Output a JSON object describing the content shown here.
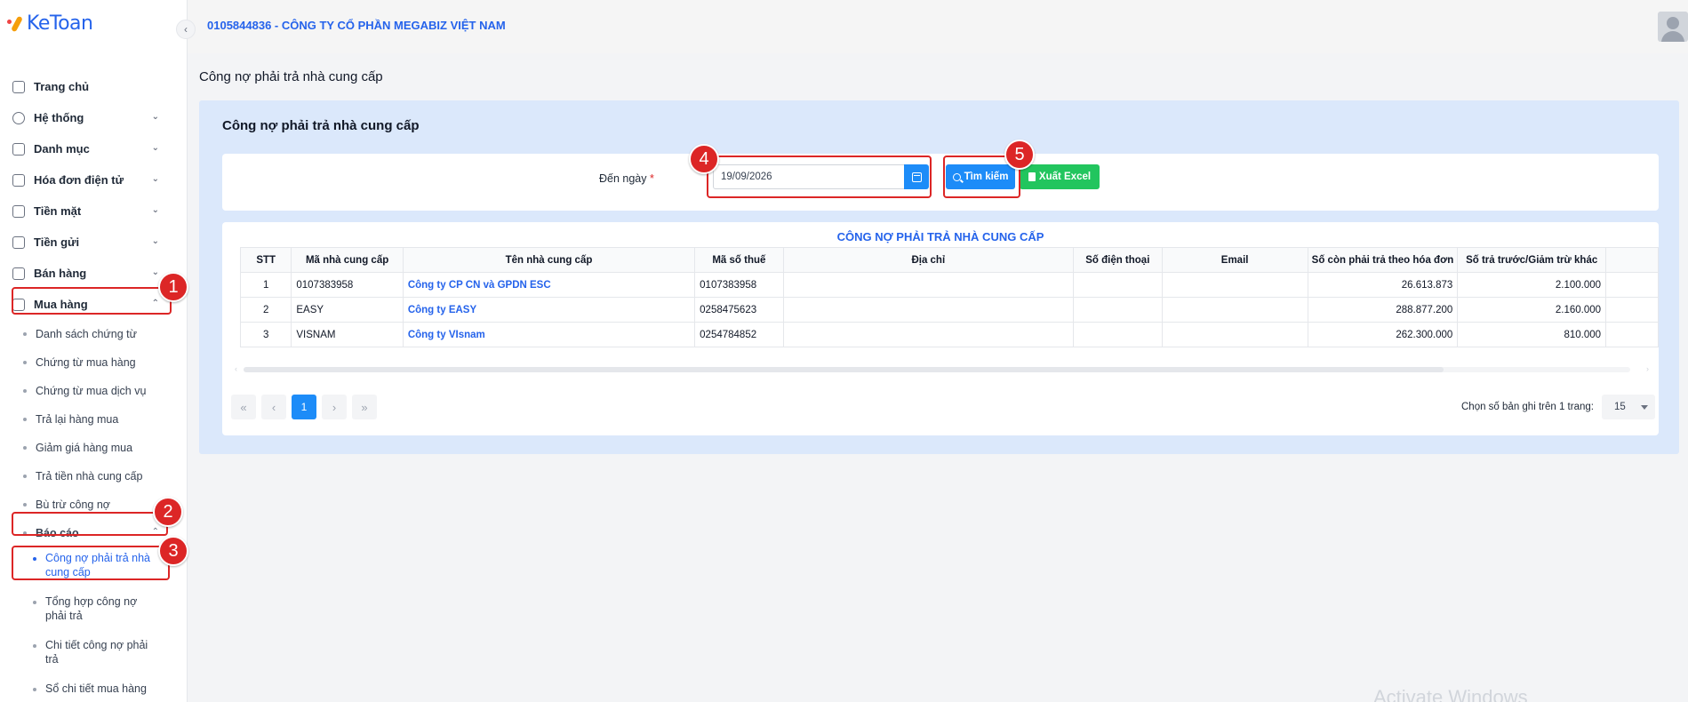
{
  "app": {
    "logo_text": "KeToan"
  },
  "header": {
    "company": "0105844836 - CÔNG TY CỔ PHẦN MEGABIZ VIỆT NAM"
  },
  "sidebar": {
    "menu": [
      {
        "label": "Trang chủ",
        "icon": "home-icon"
      },
      {
        "label": "Hệ thống",
        "icon": "gear-icon"
      },
      {
        "label": "Danh mục",
        "icon": "grid-icon"
      },
      {
        "label": "Hóa đơn điện tử",
        "icon": "invoice-icon"
      },
      {
        "label": "Tiền mặt",
        "icon": "cash-icon"
      },
      {
        "label": "Tiền gửi",
        "icon": "bank-card-icon"
      },
      {
        "label": "Bán hàng",
        "icon": "clipboard-icon"
      },
      {
        "label": "Mua hàng",
        "icon": "wallet-icon"
      }
    ],
    "purchase_sub": [
      "Danh sách chứng từ",
      "Chứng từ mua hàng",
      "Chứng từ mua dịch vụ",
      "Trả lại hàng mua",
      "Giảm giá hàng mua",
      "Trả tiền nhà cung cấp",
      "Bù trừ công nợ",
      "Báo cáo"
    ],
    "report_sub": [
      "Công nợ phải trả nhà cung cấp",
      "Tổng hợp công nợ phải trả",
      "Chi tiết công nợ phải trả",
      "Sổ chi tiết mua hàng"
    ]
  },
  "annotations": [
    "1",
    "2",
    "3",
    "4",
    "5"
  ],
  "page": {
    "title": "Công nợ phải trả nhà cung cấp",
    "panel_title": "Công nợ phải trả nhà cung cấp"
  },
  "filter": {
    "label": "Đến ngày",
    "required_mark": "*",
    "date_value": "19/09/2026",
    "search_label": "Tìm kiếm",
    "excel_label": "Xuất Excel"
  },
  "table": {
    "title": "CÔNG NỢ PHẢI TRẢ NHÀ CUNG CẤP",
    "columns": [
      "STT",
      "Mã nhà cung cấp",
      "Tên nhà cung cấp",
      "Mã số thuế",
      "Địa chỉ",
      "Số điện thoại",
      "Email",
      "Số còn phải trả theo hóa đơn",
      "Số trả trước/Giảm trừ khác"
    ],
    "rows": [
      {
        "stt": "1",
        "code": "0107383958",
        "name": "Công ty CP CN và GPDN ESC",
        "tax": "0107383958",
        "address": "",
        "phone": "",
        "email": "",
        "remaining": "26.613.873",
        "prepaid": "2.100.000"
      },
      {
        "stt": "2",
        "code": "EASY",
        "name": "Công ty EASY",
        "tax": "0258475623",
        "address": "",
        "phone": "",
        "email": "",
        "remaining": "288.877.200",
        "prepaid": "2.160.000"
      },
      {
        "stt": "3",
        "code": "VISNAM",
        "name": "Công ty VIsnam",
        "tax": "0254784852",
        "address": "",
        "phone": "",
        "email": "",
        "remaining": "262.300.000",
        "prepaid": "810.000"
      }
    ]
  },
  "pagination": {
    "current_page": "1",
    "first": "«",
    "prev": "‹",
    "next": "›",
    "last": "»",
    "per_page_label": "Chọn số bản ghi trên 1 trang:",
    "per_page_value": "15"
  },
  "watermark": "Activate Windows"
}
